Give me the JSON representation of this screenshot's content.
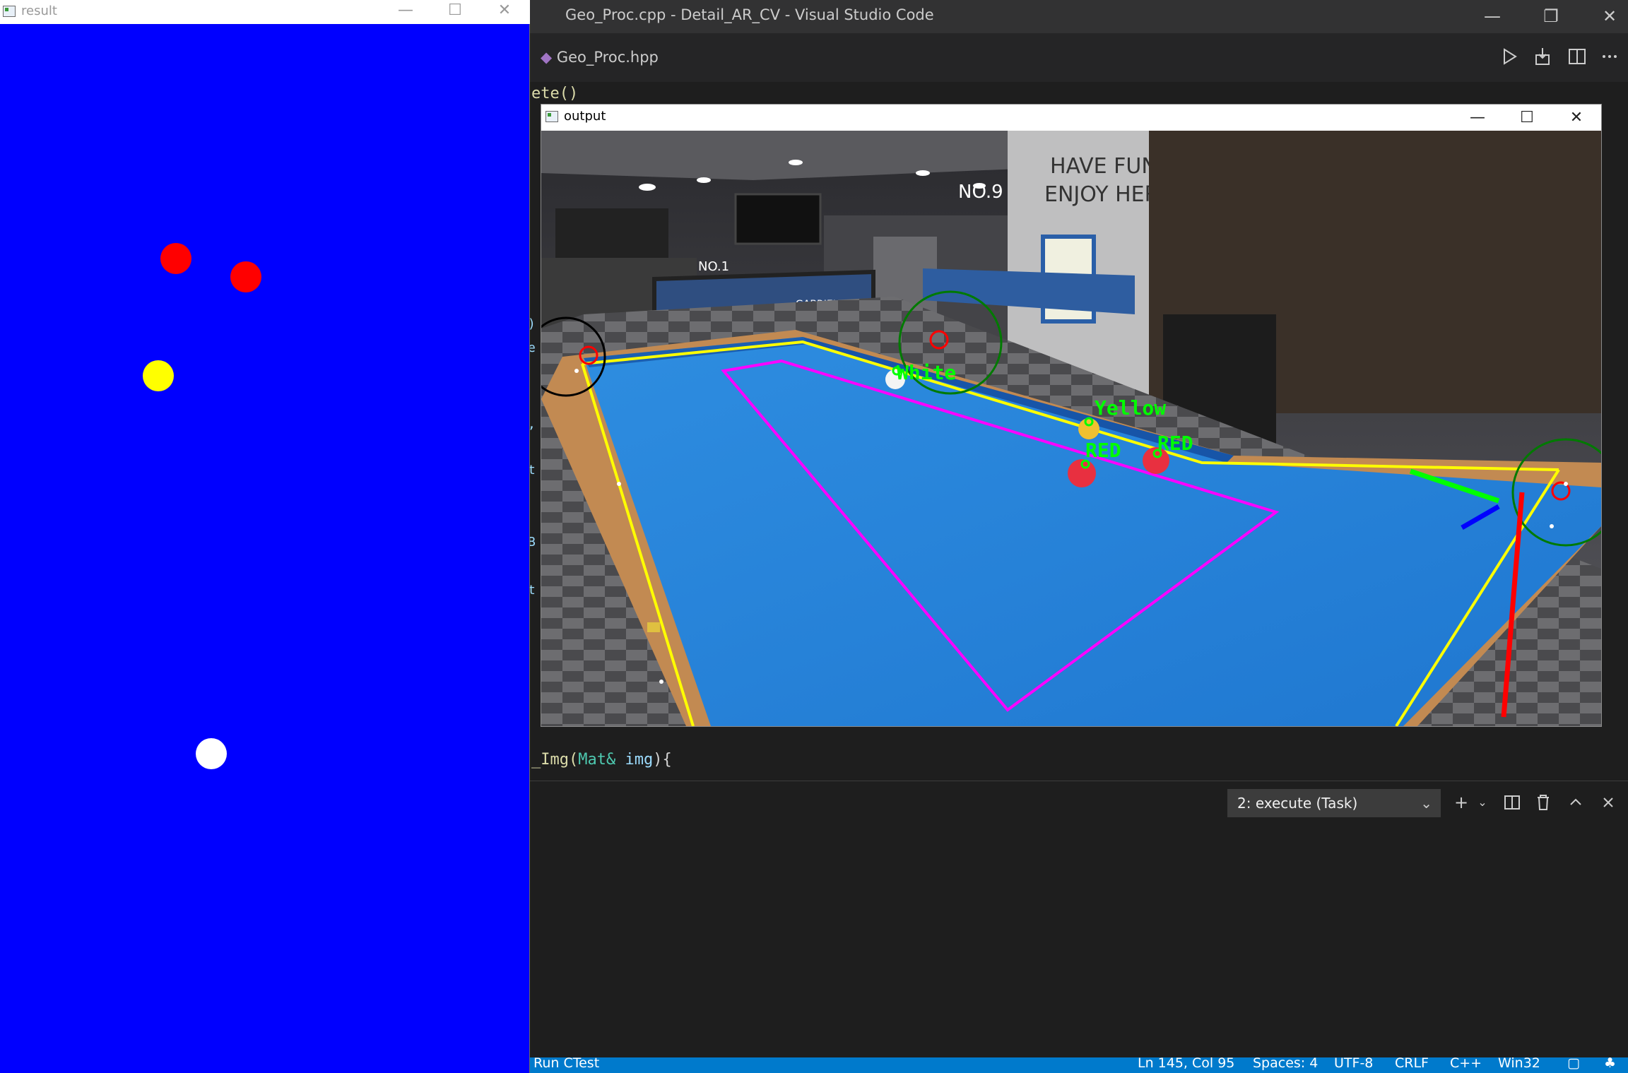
{
  "vscode": {
    "window_title": "Geo_Proc.cpp - Detail_AR_CV - Visual Studio Code",
    "tab": "Geo_Proc.hpp",
    "code_top_fragment": "ete()",
    "code_line": {
      "prefix": "_Img(",
      "type": "Mat&",
      "param": " img",
      "suffix": "){"
    },
    "side_fragments": [
      ")",
      "e",
      ",",
      "t",
      "B",
      "t"
    ],
    "terminal_select": "2: execute (Task)",
    "status": {
      "run": "Run CTest",
      "position": "Ln 145, Col 95",
      "spaces": "Spaces: 4",
      "encoding": "UTF-8",
      "eol": "CRLF",
      "language": "C++",
      "platform": "Win32"
    }
  },
  "output_window": {
    "title": "output",
    "labels": {
      "white": "White",
      "yellow": "Yellow",
      "red1": "RED",
      "red2": "RED"
    },
    "scene_text": {
      "sign_line1": "HAVE FUN &",
      "sign_line2": "ENJOY HERE",
      "no1": "NO.1",
      "no9": "NO.9",
      "brand": "GABRIELS"
    }
  },
  "result_window": {
    "title": "result",
    "background": "#0000ff",
    "balls": [
      {
        "color": "red"
      },
      {
        "color": "red"
      },
      {
        "color": "yellow"
      },
      {
        "color": "white"
      }
    ]
  }
}
